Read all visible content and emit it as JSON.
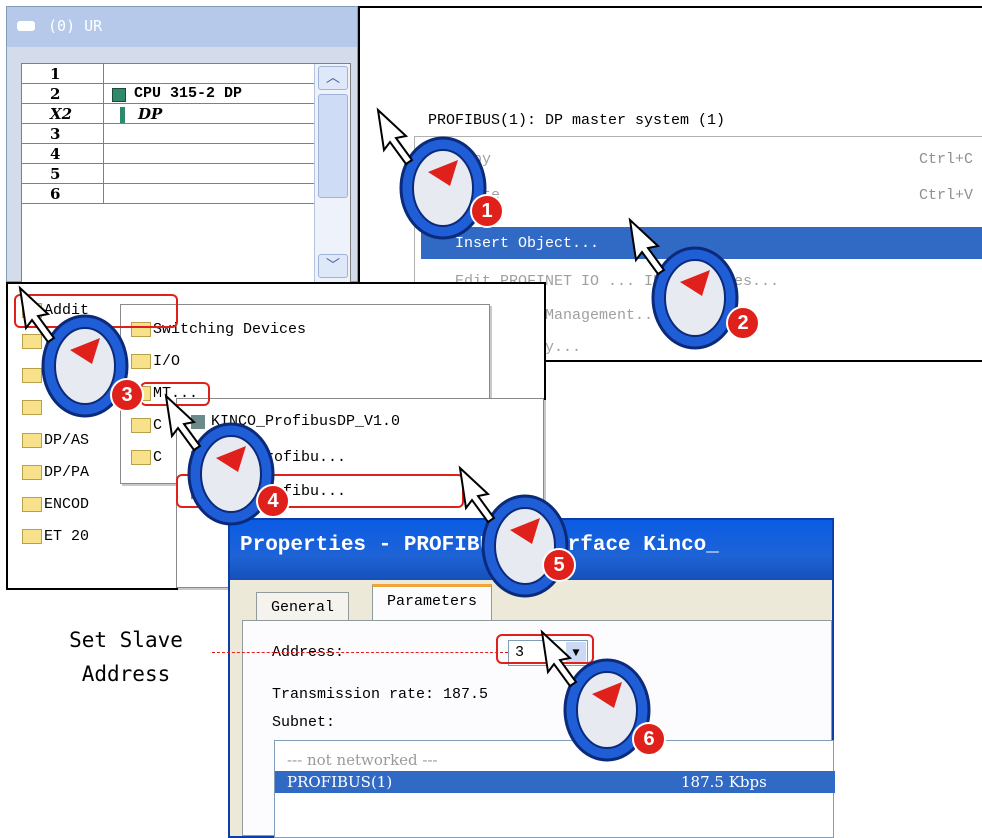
{
  "rack": {
    "title": "(0) UR",
    "rows": [
      {
        "slot": "1",
        "module": ""
      },
      {
        "slot": "2",
        "module": "CPU 315-2 DP"
      },
      {
        "slot": "X2",
        "module": "DP"
      },
      {
        "slot": "3",
        "module": ""
      },
      {
        "slot": "4",
        "module": ""
      },
      {
        "slot": "5",
        "module": ""
      },
      {
        "slot": "6",
        "module": ""
      }
    ]
  },
  "context_menu": {
    "header": "PROFIBUS(1): DP master system (1)",
    "items": [
      {
        "label": "Copy",
        "shortcut": "Ctrl+C"
      },
      {
        "label": "Paste",
        "shortcut": "Ctrl+V"
      },
      {
        "label": "Insert Object...",
        "shortcut": ""
      },
      {
        "label": "Edit PROFINET IO ... IP addresses...",
        "shortcut": ""
      },
      {
        "label": "IO Domain Management...",
        "shortcut": ""
      },
      {
        "label": "IO Topology...",
        "shortcut": ""
      }
    ]
  },
  "catalog": {
    "root_items": [
      "Addit",
      "",
      "",
      "",
      "DP/AS",
      "DP/PA",
      "ENCOD",
      "ET 20"
    ],
    "level2_items": [
      "Switching Devices",
      "I/O",
      "MT..."
    ],
    "level2_extra": [
      "C",
      "C"
    ],
    "level3_items": [
      "KINCO_ProfibusDP_V1.0",
      "MT5K_Profibu...",
      "MT5K_Profibu..."
    ]
  },
  "properties": {
    "title": "Properties - PROFIBUS interface  Kinco_",
    "tabs": [
      "General",
      "Parameters"
    ],
    "address_label": "Address:",
    "address_value": "3",
    "transmission_label": "Transmission rate: 187.5",
    "subnet_label": "Subnet:",
    "subnet_rows": [
      {
        "name": "--- not networked ---",
        "rate": ""
      },
      {
        "name": "PROFIBUS(1)",
        "rate": "187.5 Kbps"
      }
    ]
  },
  "annotation": {
    "set_slave": "Set Slave",
    "address": "Address"
  },
  "steps": [
    "1",
    "2",
    "3",
    "4",
    "5",
    "6"
  ],
  "colors": {
    "highlight": "#316ac5",
    "red": "#e0201b",
    "cursor_blue": "#1f5ed6"
  }
}
